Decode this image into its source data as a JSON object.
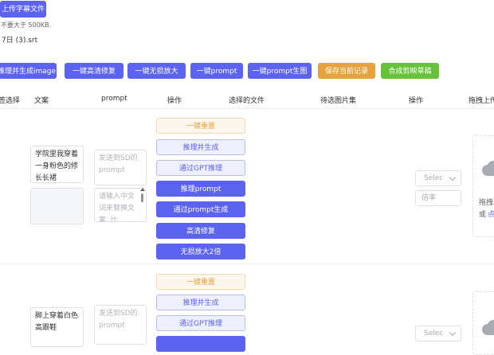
{
  "upload": {
    "button_label": "上传字幕文件",
    "hint": "不要大于 500KB.",
    "filename": "7日 (3).srt"
  },
  "toolbar": {
    "buttons": [
      "推理并生成image",
      "一键高清修复",
      "一键无损放大",
      "一键prompt",
      "一键prompt生图",
      "保存当前记录",
      "合成剪映草稿"
    ]
  },
  "table": {
    "headers": [
      "签选择",
      "文案",
      "prompt",
      "操作",
      "选择的文件",
      "待选图片集",
      "操作",
      "拖拽上传"
    ]
  },
  "rows": [
    {
      "text": "学院里我穿着一身粉色的修长长裙",
      "prompt_placeholder": "发送到SD的prompt",
      "replace_placeholder": "请输入中文词来替换文案, 比",
      "actions": [
        "一键重置",
        "推理并生成",
        "通过GPT推理",
        "推理prompt",
        "通过prompt生成",
        "高清修复",
        "无损放大2倍"
      ],
      "select_placeholder": "Selec",
      "rate_placeholder": "倍率",
      "drag_text": "拖拽",
      "drag_or": "或",
      "drag_click": "点"
    },
    {
      "text": "脚上穿着白色高跟鞋",
      "prompt_placeholder": "发送到SD的prompt",
      "actions": [
        "一键重置",
        "推理并生成",
        "通过GPT推理"
      ],
      "select_placeholder": "Selec"
    }
  ],
  "colors": {
    "primary": "#5b63f0",
    "warning": "#e6a23c",
    "success": "#67c23a"
  }
}
